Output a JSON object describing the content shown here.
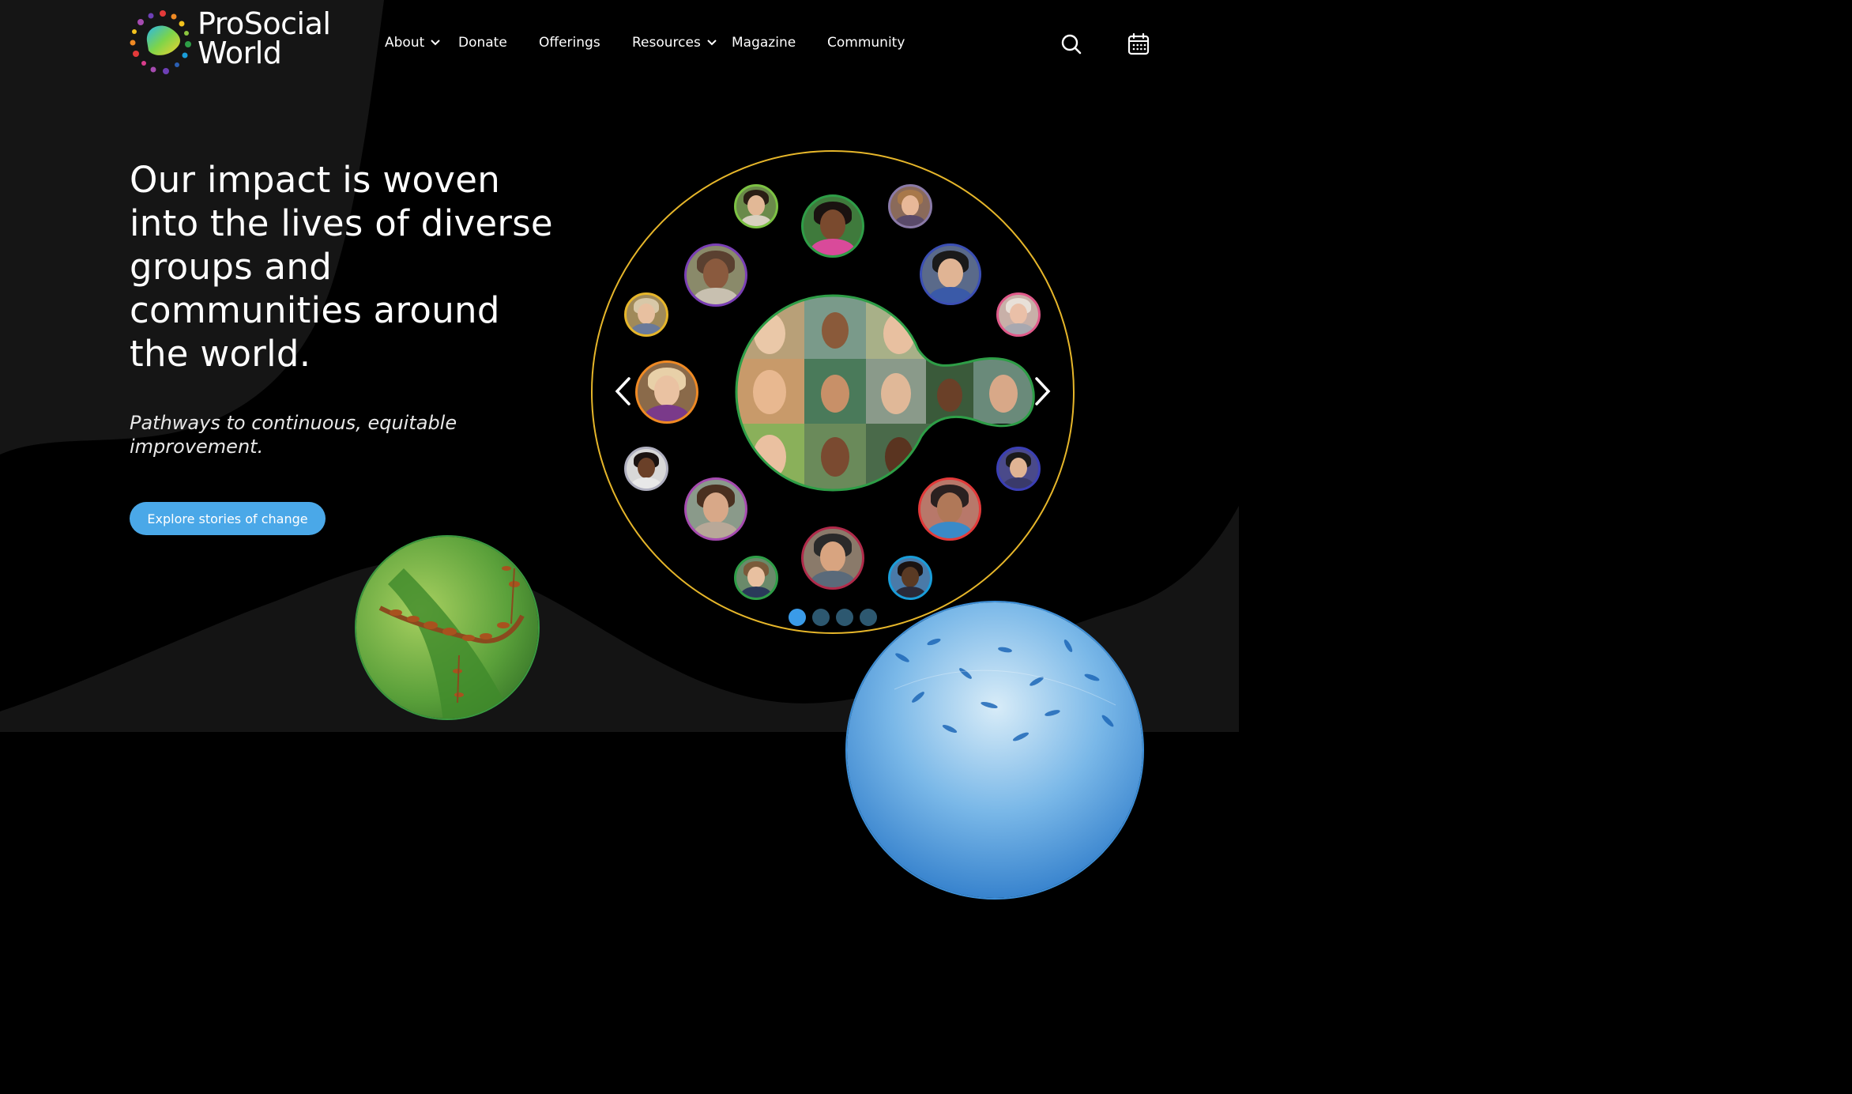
{
  "brand": {
    "line1": "ProSocial",
    "line2": "World"
  },
  "nav": {
    "items": [
      {
        "label": "About",
        "dropdown": true
      },
      {
        "label": "Donate",
        "dropdown": false
      },
      {
        "label": "Offerings",
        "dropdown": false
      },
      {
        "label": "Resources",
        "dropdown": true
      },
      {
        "label": "Magazine",
        "dropdown": false
      },
      {
        "label": "Community",
        "dropdown": false
      }
    ],
    "icons": [
      "search-icon",
      "calendar-icon"
    ]
  },
  "hero": {
    "headline": "Our impact is woven into the lives of diverse groups and communities around the world.",
    "subheadline": "Pathways to continuous, equitable improvement.",
    "cta_label": "Explore stories of change"
  },
  "carousel": {
    "slide_count": 4,
    "active_slide": 1,
    "icons": [
      "chevron-left-icon",
      "chevron-right-icon"
    ]
  },
  "colors": {
    "background": "#000000",
    "shape": "#141414",
    "accent_button": "#4aa8e8",
    "ring": "#e6b62a",
    "dot_active": "#3a9be8",
    "dot_inactive": "#2d5870"
  }
}
